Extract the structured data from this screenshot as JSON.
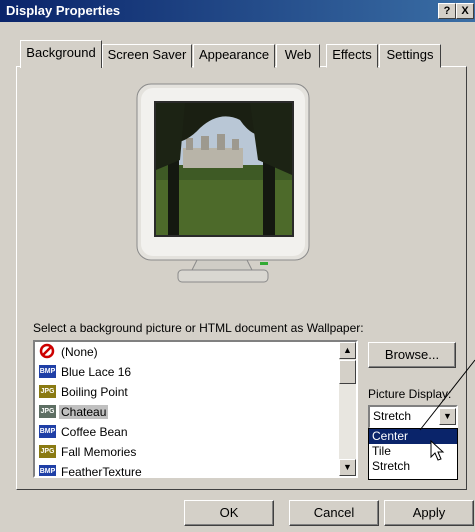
{
  "window": {
    "title": "Display Properties",
    "help_label": "?",
    "close_label": "X"
  },
  "tabs": [
    {
      "label": "Background"
    },
    {
      "label": "Screen Saver"
    },
    {
      "label": "Appearance"
    },
    {
      "label": "Web"
    },
    {
      "label": "Effects"
    },
    {
      "label": "Settings"
    }
  ],
  "wallpaper": {
    "prompt": "Select a background picture or HTML document as Wallpaper:",
    "items": [
      {
        "label": "(None)",
        "icon": "none-icon"
      },
      {
        "label": "Blue Lace 16",
        "icon": "BMP"
      },
      {
        "label": "Boiling Point",
        "icon": "JPG"
      },
      {
        "label": "Chateau",
        "icon": "JPG",
        "selected": true
      },
      {
        "label": "Coffee Bean",
        "icon": "BMP"
      },
      {
        "label": "Fall Memories",
        "icon": "JPG"
      },
      {
        "label": "FeatherTexture",
        "icon": "BMP"
      }
    ],
    "browse_label": "Browse...",
    "display_label": "Picture Display:",
    "display_value": "Stretch",
    "display_options": [
      "Center",
      "Tile",
      "Stretch"
    ],
    "highlighted_option": "Center"
  },
  "footer": {
    "ok_label": "OK",
    "cancel_label": "Cancel",
    "apply_label": "Apply"
  },
  "colors": {
    "titlebar": "#0a246a",
    "highlight": "#0a246a",
    "face": "#d4d0c8"
  }
}
